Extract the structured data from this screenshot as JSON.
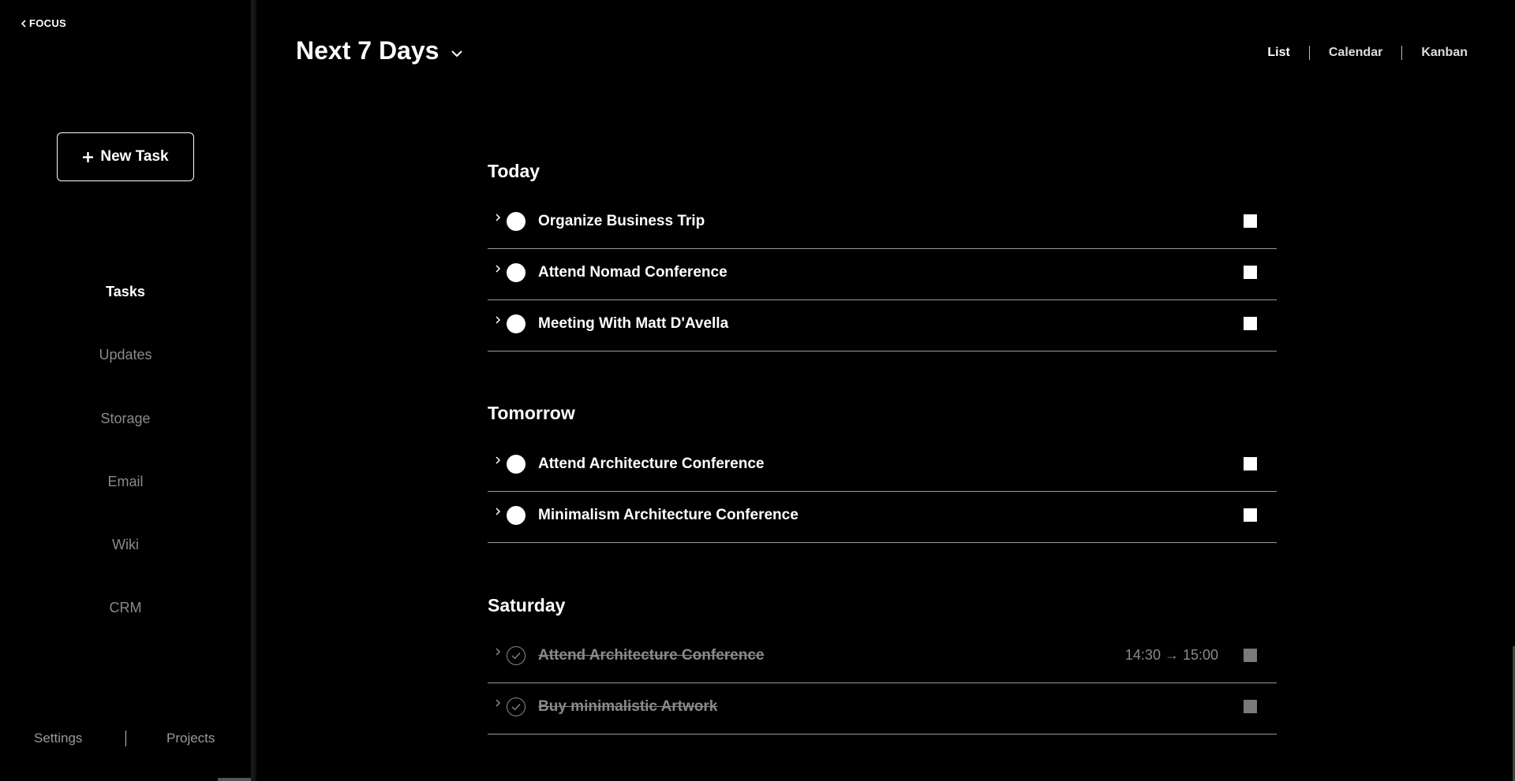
{
  "sidebar": {
    "back_label": "FOCUS",
    "new_task_label": "New Task",
    "nav": [
      {
        "label": "Tasks",
        "active": true
      },
      {
        "label": "Updates",
        "active": false
      },
      {
        "label": "Storage",
        "active": false
      },
      {
        "label": "Email",
        "active": false
      },
      {
        "label": "Wiki",
        "active": false
      },
      {
        "label": "CRM",
        "active": false
      }
    ],
    "footer": {
      "settings": "Settings",
      "projects": "Projects"
    }
  },
  "header": {
    "title": "Next 7 Days",
    "views": [
      {
        "label": "List",
        "active": true
      },
      {
        "label": "Calendar",
        "active": false
      },
      {
        "label": "Kanban",
        "active": false
      }
    ]
  },
  "sections": [
    {
      "title": "Today",
      "tasks": [
        {
          "title": "Organize Business Trip",
          "done": false,
          "time": ""
        },
        {
          "title": "Attend Nomad Conference",
          "done": false,
          "time": ""
        },
        {
          "title": "Meeting With Matt D'Avella",
          "done": false,
          "time": ""
        }
      ]
    },
    {
      "title": "Tomorrow",
      "tasks": [
        {
          "title": "Attend Architecture Conference",
          "done": false,
          "time": ""
        },
        {
          "title": "Minimalism Architecture Conference",
          "done": false,
          "time": ""
        }
      ]
    },
    {
      "title": "Saturday",
      "tasks": [
        {
          "title": "Attend Architecture Conference",
          "done": true,
          "time": "14:30 → 15:00"
        },
        {
          "title": "Buy minimalistic Artwork",
          "done": true,
          "time": ""
        }
      ]
    }
  ],
  "colors": {
    "background": "#000000",
    "text": "#ffffff",
    "muted": "#8a8a8a"
  }
}
